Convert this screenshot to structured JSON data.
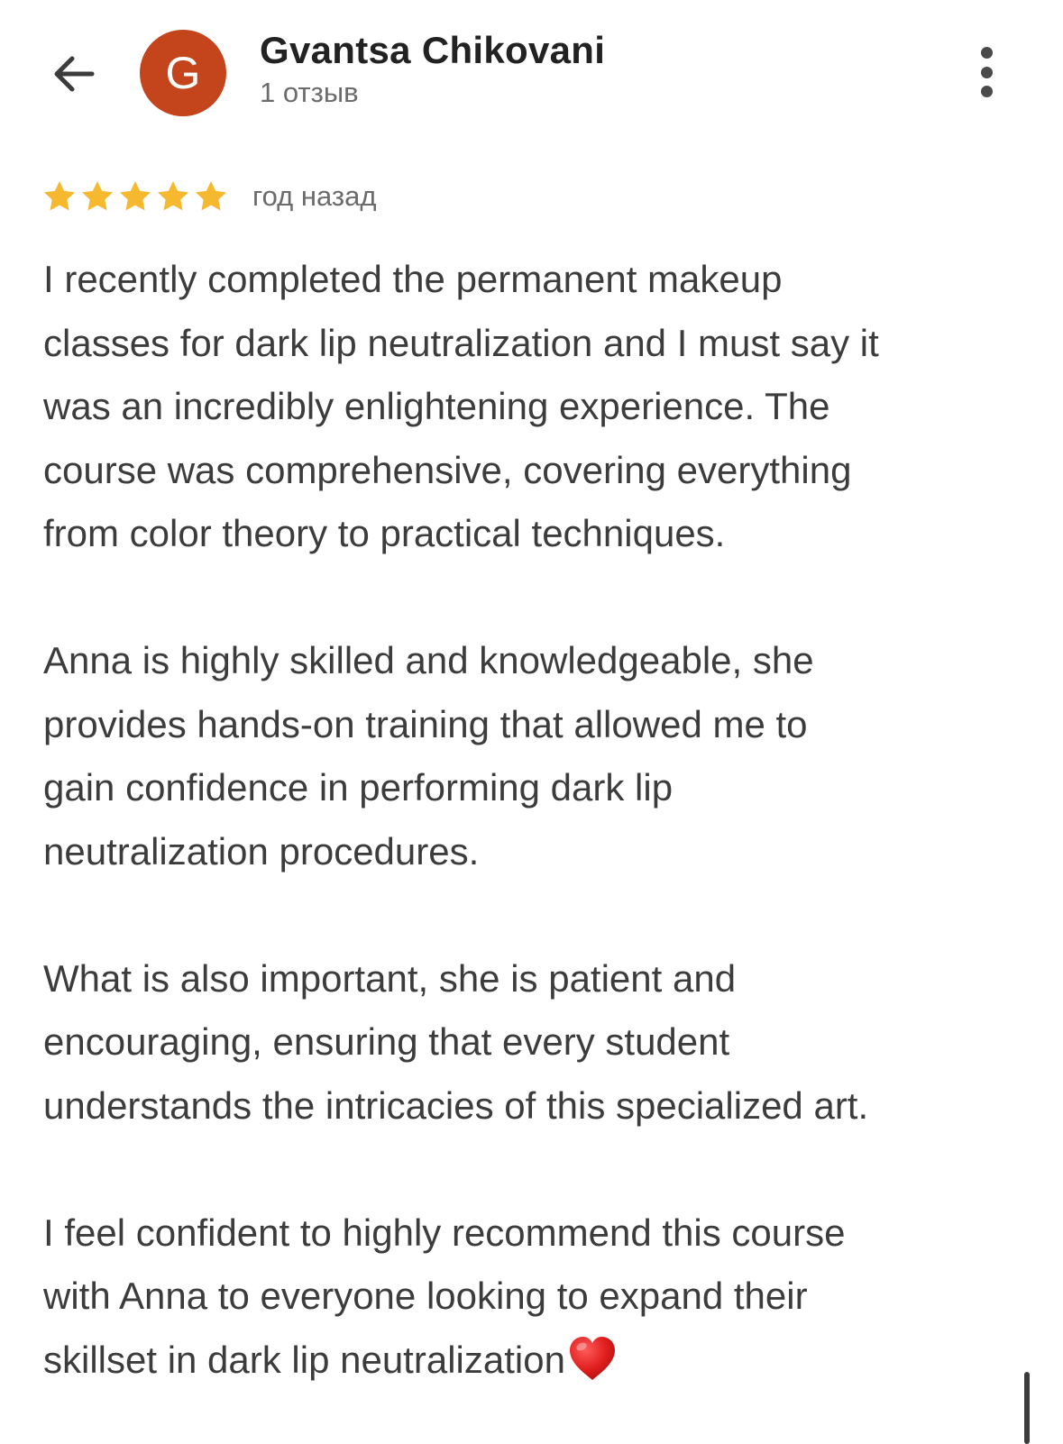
{
  "header": {
    "author_name": "Gvantsa Chikovani",
    "review_count": "1 отзыв",
    "avatar_letter": "G",
    "avatar_color": "#c4441c"
  },
  "review": {
    "rating": 5,
    "max_rating": 5,
    "date": "год назад",
    "star_color": "#f5b82e",
    "paragraphs": [
      "I recently completed the permanent makeup\nclasses for dark lip neutralization and I must say it\nwas an incredibly enlightening experience. The\ncourse was comprehensive, covering everything\nfrom color theory to practical techniques.",
      "Anna is highly skilled and knowledgeable, she\nprovides hands-on training that allowed me to\ngain confidence in performing dark lip\nneutralization procedures.",
      "What is also important, she is patient and\nencouraging, ensuring that every student\nunderstands the intricacies of this specialized art.",
      "I feel confident to highly recommend this course\nwith Anna to everyone looking to expand their\nskillset in dark lip neutralization"
    ],
    "trailing_emoji": "heart-icon"
  }
}
